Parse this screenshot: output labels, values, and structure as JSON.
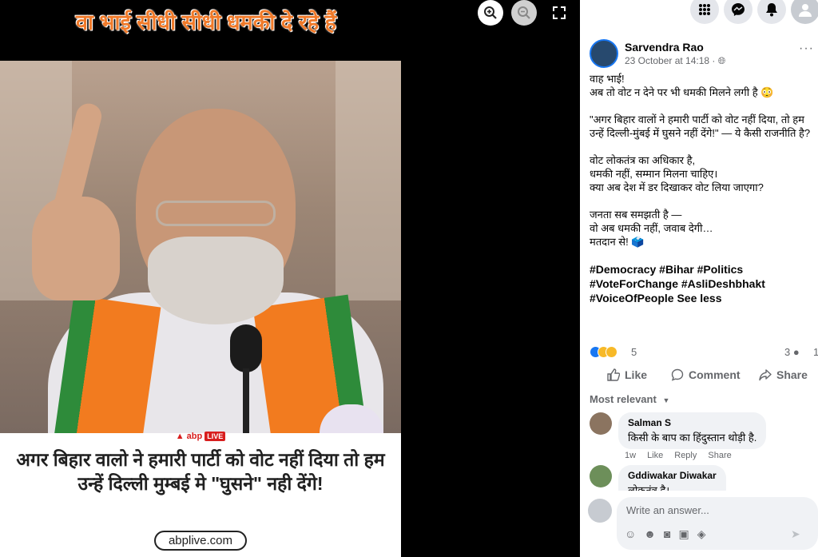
{
  "viewer": {
    "overlay_title": "वा भाई सीधी सीधी धमकी दे रहे हैं",
    "card": {
      "logo_text": "abp",
      "logo_live": "LIVE",
      "headline": "अगर बिहार वालो ने हमारी पार्टी को वोट नहीं दिया तो हम उन्हें दिल्ली मुम्बई मे \"घुसने\" नही देंगे!",
      "site": "abplive.com"
    },
    "controls": {
      "zoom_in_icon": "zoom-in-icon",
      "zoom_out_icon": "zoom-out-icon",
      "fullscreen_icon": "fullscreen-icon"
    }
  },
  "topbar": {
    "messenger_badge": "",
    "notifications_badge": "",
    "account_badge": ""
  },
  "post": {
    "author": "Sarvendra Rao",
    "date": "23 October at 14:18 · ",
    "paragraphs": [
      "वाह भाई!\nअब तो वोट न देने पर भी धमकी मिलने लगी है 😳",
      "\"अगर बिहार वालों ने हमारी पार्टी को वोट नहीं दिया, तो हम उन्हें दिल्ली-मुंबई में घुसने नहीं देंगे!\" — ये कैसी राजनीति है?",
      "वोट लोकतंत्र का अधिकार है,\nधमकी नहीं, सम्मान मिलना चाहिए।\nक्या अब देश में डर दिखाकर वोट लिया जाएगा?",
      "जनता सब समझती है —\nवो अब धमकी नहीं, जवाब देगी…\nमतदान से! 🗳️"
    ],
    "hashtags_line1": "#Democracy #Bihar #Politics",
    "hashtags_line2": "#VoteForChange #AsliDeshbhakt",
    "hashtags_line3": "#VoiceOfPeople",
    "see_less": "See less",
    "reaction_count": "5",
    "comment_count": "3",
    "share_count": "1",
    "actions": {
      "like": "Like",
      "comment": "Comment",
      "share": "Share"
    },
    "sort_label": "Most relevant"
  },
  "comments": [
    {
      "name": "Salman S",
      "text": "किसी के बाप का हिंदुस्तान थोड़ी है.",
      "time": "1w",
      "like": "Like",
      "reply": "Reply",
      "share": "Share"
    },
    {
      "name": "Gddiwakar Diwakar",
      "text": "लोकतंत्र है।"
    }
  ],
  "compose": {
    "placeholder": "Write an answer..."
  },
  "colors": {
    "accent": "#1877f2",
    "overlay_title": "#f07a2a",
    "abp_red": "#d81e1e"
  }
}
